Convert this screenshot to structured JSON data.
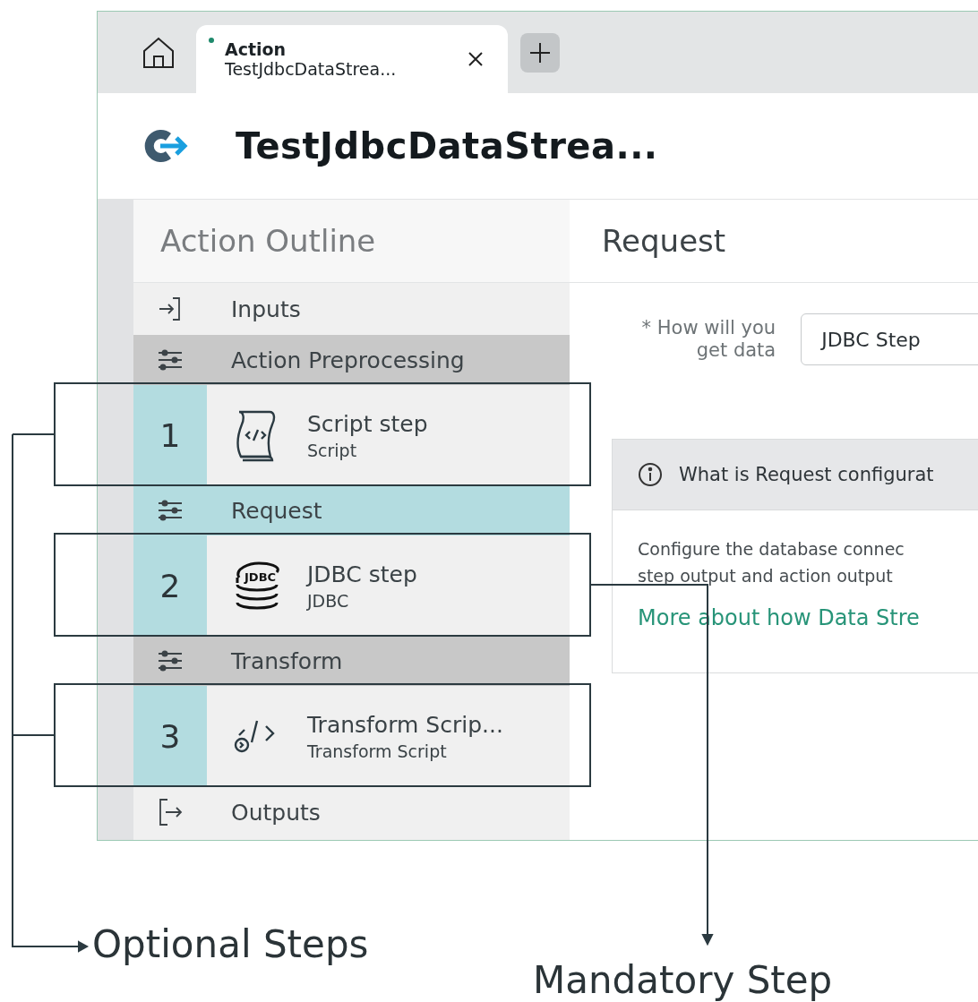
{
  "tabs": [
    {
      "kind": "home"
    },
    {
      "kind": "document",
      "type_label": "Action",
      "title": "TestJdbcDataStrea...",
      "selected": true,
      "modified": true
    }
  ],
  "header": {
    "title": "TestJdbcDataStrea..."
  },
  "outline": {
    "title": "Action Outline",
    "items": [
      {
        "kind": "inputs",
        "label": "Inputs"
      },
      {
        "kind": "group",
        "label": "Action Preprocessing",
        "selected": false
      },
      {
        "kind": "step",
        "number": "1",
        "title": "Script step",
        "subtitle": "Script"
      },
      {
        "kind": "group",
        "label": "Request",
        "selected": true
      },
      {
        "kind": "step",
        "number": "2",
        "title": "JDBC step",
        "subtitle": "JDBC",
        "icon_label": "JDBC"
      },
      {
        "kind": "group",
        "label": "Transform",
        "selected": false
      },
      {
        "kind": "step",
        "number": "3",
        "title": "Transform Scrip...",
        "subtitle": "Transform Script"
      },
      {
        "kind": "outputs",
        "label": "Outputs"
      }
    ]
  },
  "panel": {
    "title": "Request",
    "field": {
      "required_mark": "*",
      "label": "How will you get data",
      "value": "JDBC Step"
    },
    "info": {
      "title": "What is Request configurat",
      "lines": [
        "Configure the database connec",
        "step output and action output"
      ],
      "link": "More about how Data Stre"
    }
  },
  "annotations": [
    {
      "kind": "optional",
      "label": "Optional Steps"
    },
    {
      "kind": "mandatory",
      "label": "Mandatory Step"
    }
  ]
}
